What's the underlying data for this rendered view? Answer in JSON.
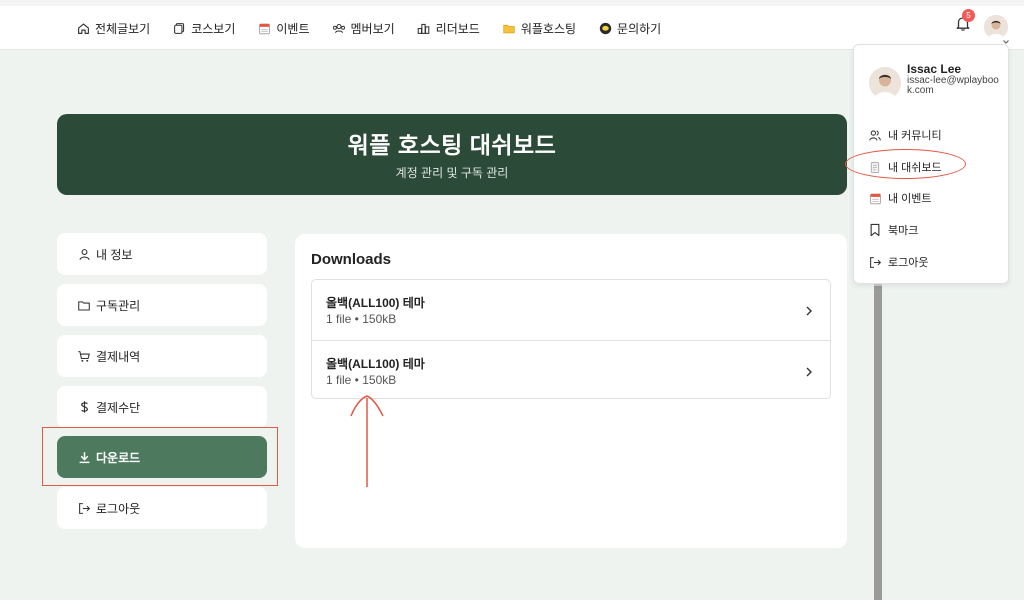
{
  "nav": {
    "items": [
      {
        "label": "전체글보기",
        "icon": "home-icon"
      },
      {
        "label": "코스보기",
        "icon": "courses-icon"
      },
      {
        "label": "이벤트",
        "icon": "calendar-icon"
      },
      {
        "label": "멤버보기",
        "icon": "members-icon"
      },
      {
        "label": "리더보드",
        "icon": "leaderboard-icon"
      },
      {
        "label": "워플호스팅",
        "icon": "folder-icon"
      },
      {
        "label": "문의하기",
        "icon": "chat-icon"
      }
    ],
    "notification_count": "5"
  },
  "hero": {
    "title": "워플 호스팅 대쉬보드",
    "subtitle": "계정 관리 및 구독 관리"
  },
  "sidebar": {
    "items": [
      {
        "label": "내 정보",
        "icon": "user-icon"
      },
      {
        "label": "구독관리",
        "icon": "folder-icon"
      },
      {
        "label": "결제내역",
        "icon": "cart-icon"
      },
      {
        "label": "결제수단",
        "icon": "dollar-icon"
      },
      {
        "label": "다운로드",
        "icon": "download-icon"
      },
      {
        "label": "로그아웃",
        "icon": "logout-icon"
      }
    ],
    "active_index": 4
  },
  "downloads": {
    "title": "Downloads",
    "items": [
      {
        "name": "올백(ALL100) 테마",
        "meta": "1 file • 150kB"
      },
      {
        "name": "올백(ALL100) 테마",
        "meta": "1 file • 150kB"
      }
    ]
  },
  "user_menu": {
    "name": "Issac Lee",
    "email": "issac-lee@wplaybook.com",
    "items": [
      {
        "label": "내 커뮤니티",
        "icon": "users-icon"
      },
      {
        "label": "내 대쉬보드",
        "icon": "dashboard-icon"
      },
      {
        "label": "내 이벤트",
        "icon": "calendar-icon"
      },
      {
        "label": "북마크",
        "icon": "bookmark-icon"
      },
      {
        "label": "로그아웃",
        "icon": "logout-icon"
      }
    ]
  },
  "colors": {
    "hero_bg": "#2c4a38",
    "active_bg": "#4d7a5e",
    "page_bg": "#eef3f0",
    "annotation": "#e05a45",
    "badge": "#ef5a5a"
  }
}
